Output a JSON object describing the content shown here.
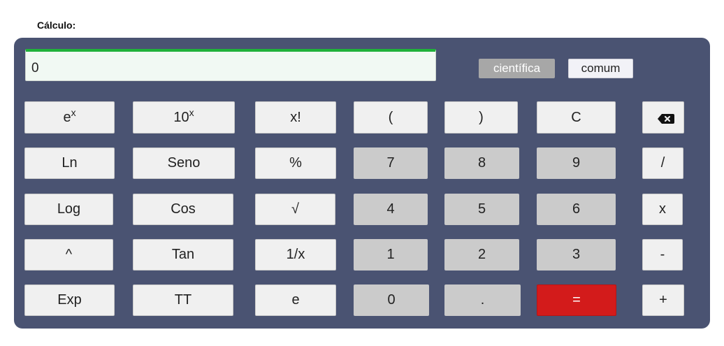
{
  "heading": "Cálculo:",
  "display": {
    "value": "0"
  },
  "modes": {
    "scientific": "científica",
    "common": "comum"
  },
  "keys": {
    "ex_base": "e",
    "ex_sup": "x",
    "tenx_base": "10",
    "tenx_sup": "x",
    "fact": "x!",
    "lparen": "(",
    "rparen": ")",
    "clear": "C",
    "backspace_icon": "backspace-icon",
    "ln": "Ln",
    "sin": "Seno",
    "percent": "%",
    "seven": "7",
    "eight": "8",
    "nine": "9",
    "divide": "/",
    "log": "Log",
    "cos": "Cos",
    "sqrt": "√",
    "four": "4",
    "five": "5",
    "six": "6",
    "multiply": "x",
    "pow": "^",
    "tan": "Tan",
    "reciprocal": "1/x",
    "one": "1",
    "two": "2",
    "three": "3",
    "minus": "-",
    "exp": "Exp",
    "pi": "TT",
    "euler": "e",
    "zero": "0",
    "dot": ".",
    "equals": "=",
    "plus": "+"
  },
  "colors": {
    "panel": "#4a5372",
    "display_accent": "#20b13a",
    "equals": "#d31b1b",
    "number_key": "#cbcbcb",
    "function_key": "#f0f0f0"
  }
}
